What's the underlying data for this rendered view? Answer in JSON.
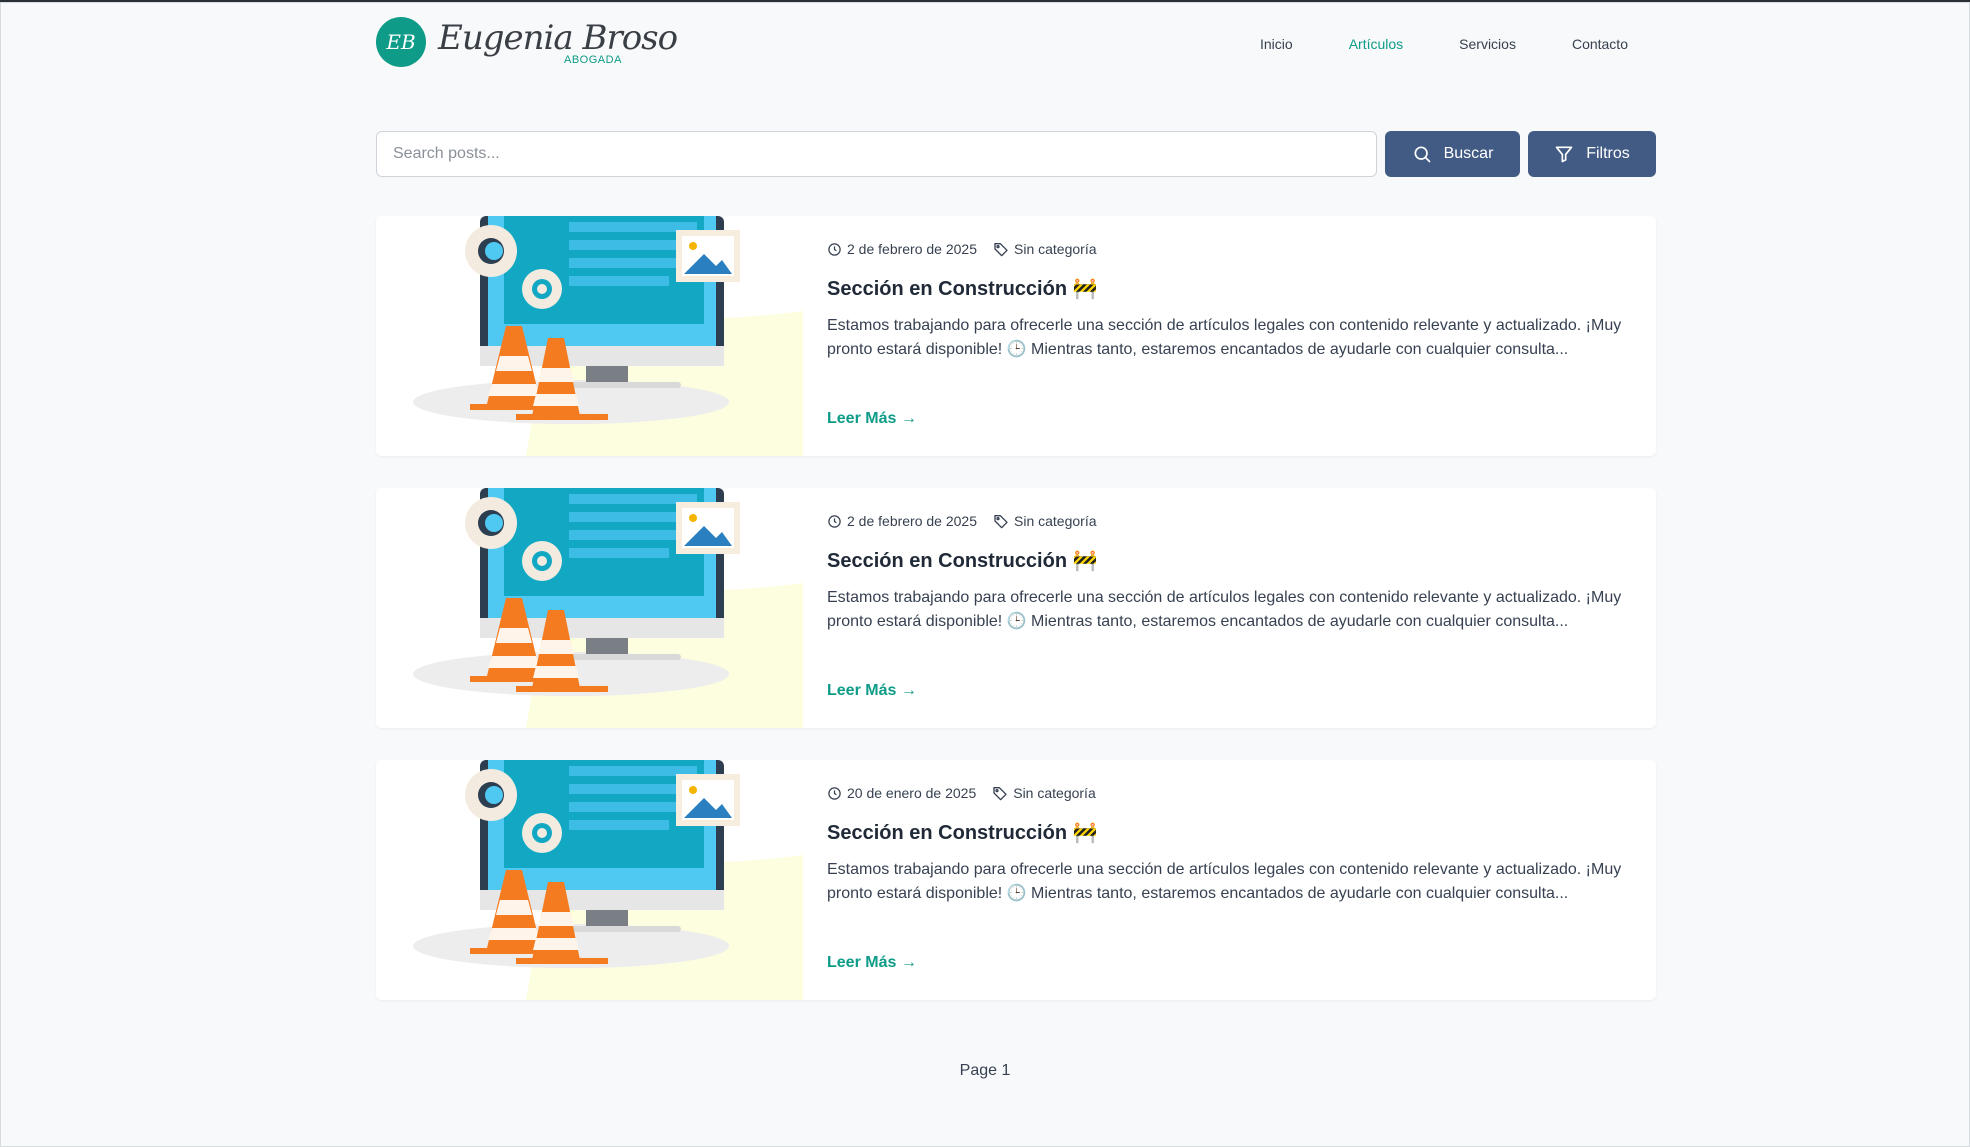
{
  "header": {
    "logo_initials": "EB",
    "logo_name": "Eugenia Broso",
    "logo_subtitle": "ABOGADA",
    "nav": [
      {
        "label": "Inicio",
        "active": false
      },
      {
        "label": "Artículos",
        "active": true
      },
      {
        "label": "Servicios",
        "active": false
      },
      {
        "label": "Contacto",
        "active": false
      }
    ]
  },
  "search": {
    "placeholder": "Search posts...",
    "value": "",
    "search_button": "Buscar",
    "filter_button": "Filtros"
  },
  "posts": [
    {
      "date": "2 de febrero de 2025",
      "category": "Sin categoría",
      "title": "Sección en Construcción 🚧",
      "excerpt": "Estamos trabajando para ofrecerle una sección de artículos legales con contenido relevante y actualizado. ¡Muy pronto estará disponible! 🕒 Mientras tanto, estaremos encantados de ayudarle con cualquier consulta...",
      "read_more": "Leer Más →"
    },
    {
      "date": "2 de febrero de 2025",
      "category": "Sin categoría",
      "title": "Sección en Construcción 🚧",
      "excerpt": "Estamos trabajando para ofrecerle una sección de artículos legales con contenido relevante y actualizado. ¡Muy pronto estará disponible! 🕒 Mientras tanto, estaremos encantados de ayudarle con cualquier consulta...",
      "read_more": "Leer Más →"
    },
    {
      "date": "20 de enero de 2025",
      "category": "Sin categoría",
      "title": "Sección en Construcción 🚧",
      "excerpt": "Estamos trabajando para ofrecerle una sección de artículos legales con contenido relevante y actualizado. ¡Muy pronto estará disponible! 🕒 Mientras tanto, estaremos encantados de ayudarle con cualquier consulta...",
      "read_more": "Leer Más →"
    }
  ],
  "pagination": {
    "label": "Page 1"
  },
  "colors": {
    "accent": "#0e9c88",
    "button": "#425b84",
    "background": "#f8f9fa"
  }
}
